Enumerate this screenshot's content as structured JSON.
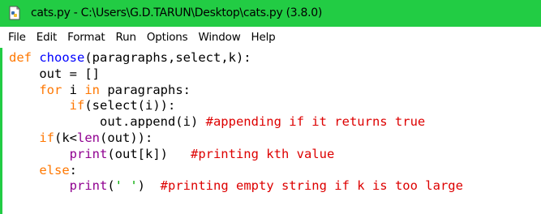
{
  "window": {
    "title": "cats.py - C:\\Users\\G.D.TARUN\\Desktop\\cats.py (3.8.0)",
    "icon": "python-file-icon",
    "titlebar_color": "#22cc44"
  },
  "menu": [
    "File",
    "Edit",
    "Format",
    "Run",
    "Options",
    "Window",
    "Help"
  ],
  "code": {
    "colors": {
      "keyword": "#ff7700",
      "definition": "#0000ff",
      "builtin": "#900090",
      "string": "#00aa00",
      "comment": "#dd0000",
      "default": "#000000"
    },
    "lines": [
      [
        {
          "t": "kw",
          "v": "def"
        },
        {
          "t": "",
          "v": " "
        },
        {
          "t": "def",
          "v": "choose"
        },
        {
          "t": "",
          "v": "(paragraphs,select,k):"
        }
      ],
      [
        {
          "t": "",
          "v": "    out = []"
        }
      ],
      [
        {
          "t": "",
          "v": "    "
        },
        {
          "t": "kw",
          "v": "for"
        },
        {
          "t": "",
          "v": " i "
        },
        {
          "t": "kw",
          "v": "in"
        },
        {
          "t": "",
          "v": " paragraphs:"
        }
      ],
      [
        {
          "t": "",
          "v": "        "
        },
        {
          "t": "kw",
          "v": "if"
        },
        {
          "t": "",
          "v": "(select(i)):"
        }
      ],
      [
        {
          "t": "",
          "v": "            out.append(i) "
        },
        {
          "t": "cm",
          "v": "#appending if it returns true"
        }
      ],
      [
        {
          "t": "",
          "v": "    "
        },
        {
          "t": "kw",
          "v": "if"
        },
        {
          "t": "",
          "v": "(k<"
        },
        {
          "t": "bi",
          "v": "len"
        },
        {
          "t": "",
          "v": "(out)):"
        }
      ],
      [
        {
          "t": "",
          "v": "        "
        },
        {
          "t": "bi",
          "v": "print"
        },
        {
          "t": "",
          "v": "(out[k])   "
        },
        {
          "t": "cm",
          "v": "#printing kth value"
        }
      ],
      [
        {
          "t": "",
          "v": "    "
        },
        {
          "t": "kw",
          "v": "else"
        },
        {
          "t": "",
          "v": ":"
        }
      ],
      [
        {
          "t": "",
          "v": "        "
        },
        {
          "t": "bi",
          "v": "print"
        },
        {
          "t": "",
          "v": "("
        },
        {
          "t": "str",
          "v": "' '"
        },
        {
          "t": "",
          "v": ")  "
        },
        {
          "t": "cm",
          "v": "#printing empty string if k is too large"
        }
      ]
    ]
  }
}
